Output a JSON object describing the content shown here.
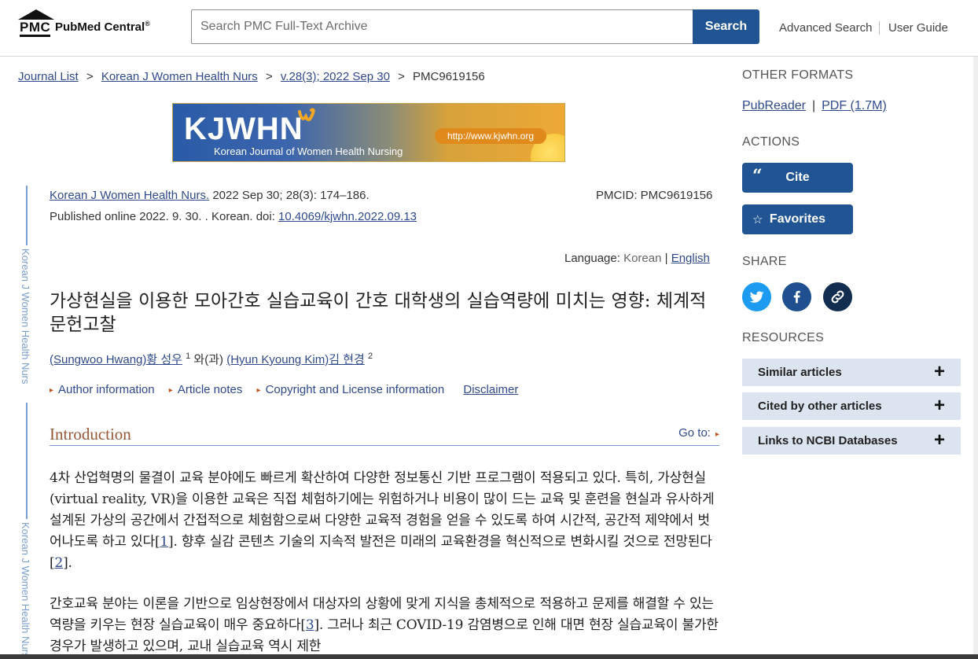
{
  "header": {
    "logo_pmc": "PMC",
    "logo_name": "PubMed Central",
    "logo_reg": "®",
    "search_placeholder": "Search PMC Full-Text Archive",
    "search_button": "Search",
    "advanced_search": "Advanced Search",
    "user_guide": "User Guide"
  },
  "breadcrumb": {
    "items": [
      "Journal List",
      "Korean J Women Health Nurs",
      "v.28(3); 2022 Sep 30"
    ],
    "current": "PMC9619156",
    "separator": ">"
  },
  "banner": {
    "title": "KJWHN",
    "subtitle": "Korean Journal of Women Health Nursing",
    "url": "http://www.kjwhn.org"
  },
  "vertical_tab": {
    "label": "Korean J Women Health Nurs"
  },
  "citation": {
    "journal": "Korean J Women Health Nurs.",
    "details": " 2022 Sep 30; 28(3): 174–186.",
    "published_prefix": "Published online 2022. 9. 30. . Korean. doi: ",
    "doi": "10.4069/kjwhn.2022.09.13",
    "pmcid": "PMCID: PMC9619156"
  },
  "language": {
    "label": "Language: ",
    "current": "Korean",
    "separator": " | ",
    "other": "English"
  },
  "article": {
    "title": "가상현실을 이용한 모아간호 실습교육이 간호 대학생의 실습역량에 미치는 영향: 체계적 문헌고찰",
    "author1": "(Sungwoo Hwang)황 성우",
    "author1_sup": "1",
    "conj": " 와(과) ",
    "author2": "(Hyun Kyoung Kim)김 현경",
    "author2_sup": "2"
  },
  "meta_links": {
    "author_info": "Author information",
    "article_notes": "Article notes",
    "copyright": "Copyright and License information",
    "disclaimer": "Disclaimer"
  },
  "section": {
    "heading": "Introduction",
    "goto": "Go to:"
  },
  "paragraphs": {
    "p1_a": "4차 산업혁명의 물결이 교육 분야에도 빠르게 확산하여 다양한 정보통신 기반 프로그램이 적용되고 있다. 특히, 가상현실(virtual reality, VR)을 이용한 교육은 직접 체험하기에는 위험하거나 비용이 많이 드는 교육 및 훈련을 현실과 유사하게 설계된 가상의 공간에서 간접적으로 체험함으로써 다양한 교육적 경험을 얻을 수 있도록 하여 시간적, 공간적 제약에서 벗어나도록 하고 있다",
    "p1_ref1": "1",
    "p1_b": ". 향후 실감 콘텐츠 기술의 지속적 발전은 미래의 교육환경을 혁신적으로 변화시킬 것으로 전망된다",
    "p1_ref2": "2",
    "p1_c": ".",
    "p2_a": "간호교육 분야는 이론을 기반으로 임상현장에서 대상자의 상황에 맞게 지식을 총체적으로 적용하고 문제를 해결할 수 있는 역량을 키우는 현장 실습교육이 매우 중요하다",
    "p2_ref1": "3",
    "p2_b": ". 그러나 최근 COVID-19 감염병으로 인해 대면 현장 실습교육이 불가한 경우가 발생하고 있으며, 교내 실습교육 역시 제한"
  },
  "sidebar": {
    "other_formats": "OTHER FORMATS",
    "pubreader": "PubReader",
    "fmt_sep": "|",
    "pdf": "PDF (1.7M)",
    "actions": "ACTIONS",
    "cite": "Cite",
    "favorites": "Favorites",
    "share": "SHARE",
    "resources": "RESOURCES",
    "resource_items": [
      "Similar articles",
      "Cited by other articles",
      "Links to NCBI Databases"
    ],
    "plus": "+"
  },
  "colors": {
    "primary": "#205493",
    "link": "#2f4a8b",
    "heading_accent": "#985735",
    "twitter": "#1d9bf0",
    "facebook": "#1f4f8f",
    "permalink": "#112e51",
    "resource_bg": "#dce4ef"
  }
}
